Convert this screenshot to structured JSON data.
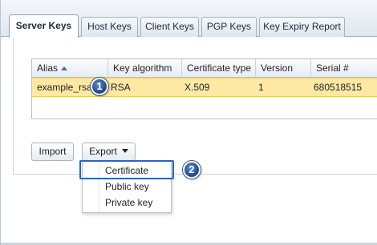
{
  "tabs": [
    {
      "label": "Server Keys",
      "active": true
    },
    {
      "label": "Host Keys",
      "active": false
    },
    {
      "label": "Client Keys",
      "active": false
    },
    {
      "label": "PGP Keys",
      "active": false
    },
    {
      "label": "Key Expiry Report",
      "active": false
    }
  ],
  "grid": {
    "columns": [
      "Alias",
      "Key algorithm",
      "Certificate type",
      "Version",
      "Serial #"
    ],
    "sort": {
      "column": "Alias",
      "direction": "ascending"
    },
    "rows": [
      {
        "alias": "example_rsa",
        "algorithm": "RSA",
        "cert_type": "X.509",
        "version": "1",
        "serial": "680518515",
        "selected": true
      }
    ]
  },
  "buttons": {
    "import": "Import",
    "export": "Export"
  },
  "export_menu": {
    "items": [
      "Certificate",
      "Public key",
      "Private key"
    ],
    "highlighted": "Certificate"
  },
  "callouts": [
    "1",
    "2"
  ],
  "colors": {
    "selected_row": "#fde9a4",
    "highlight_border": "#2a64c9",
    "badge": "#2a5298"
  }
}
